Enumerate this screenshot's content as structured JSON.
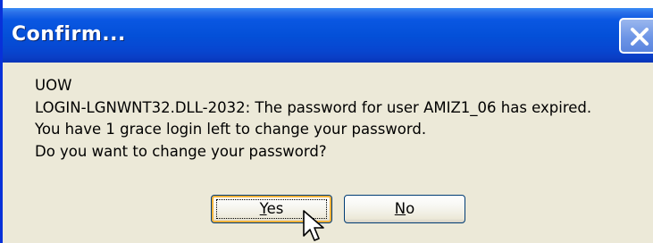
{
  "window": {
    "title": "Confirm...",
    "close_icon": "close-icon"
  },
  "message": {
    "lines": [
      "UOW",
      "LOGIN-LGNWNT32.DLL-2032: The password for user AMIZ1_06 has expired.",
      "You have 1 grace login left to change your password.",
      "Do you want to change your password?"
    ]
  },
  "buttons": {
    "yes": {
      "mnemonic": "Y",
      "rest": "es",
      "default": true
    },
    "no": {
      "mnemonic": "N",
      "rest": "o",
      "default": false
    }
  },
  "cursor": {
    "icon": "arrow-cursor-icon"
  },
  "colors": {
    "titlebar": "#0450d8",
    "dialog_bg": "#ece9d8",
    "default_button_ring": "#f8b33a",
    "button_border": "#003c74"
  }
}
